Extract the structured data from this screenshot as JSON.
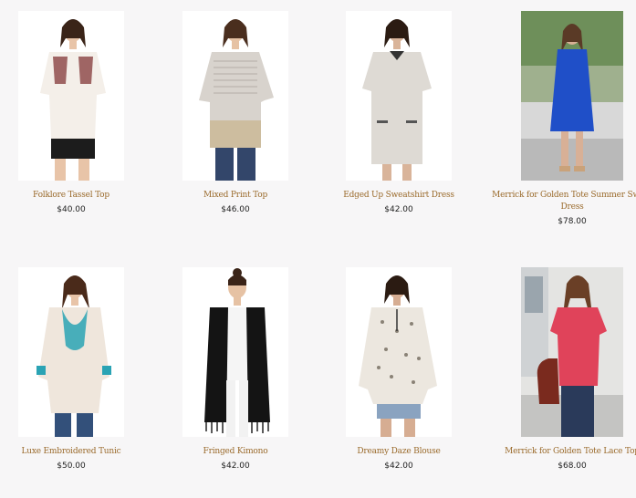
{
  "products": [
    {
      "name": "Folklore Tassel Top",
      "price": "$40.00",
      "image": "model-white-embroidered-top"
    },
    {
      "name": "Mixed Print Top",
      "price": "$46.00",
      "image": "model-gray-stripe-top"
    },
    {
      "name": "Edged Up Sweatshirt Dress",
      "price": "$42.00",
      "image": "model-gray-sweatshirt-dress"
    },
    {
      "name": "Merrick for Golden Tote Summer Swing Dress",
      "price": "$78.00",
      "image": "outdoor-blue-swing-dress"
    },
    {
      "name": "Luxe Embroidered Tunic",
      "price": "$50.00",
      "image": "model-white-teal-tunic"
    },
    {
      "name": "Fringed Kimono",
      "price": "$42.00",
      "image": "model-black-fringe-kimono"
    },
    {
      "name": "Dreamy Daze Blouse",
      "price": "$42.00",
      "image": "model-print-blouse"
    },
    {
      "name": "Merrick for Golden Tote Lace Top",
      "price": "$68.00",
      "image": "outdoor-pink-lace-top"
    }
  ],
  "colors": {
    "title": "#9a6a2b",
    "price": "#222222",
    "background": "#f7f6f7"
  }
}
